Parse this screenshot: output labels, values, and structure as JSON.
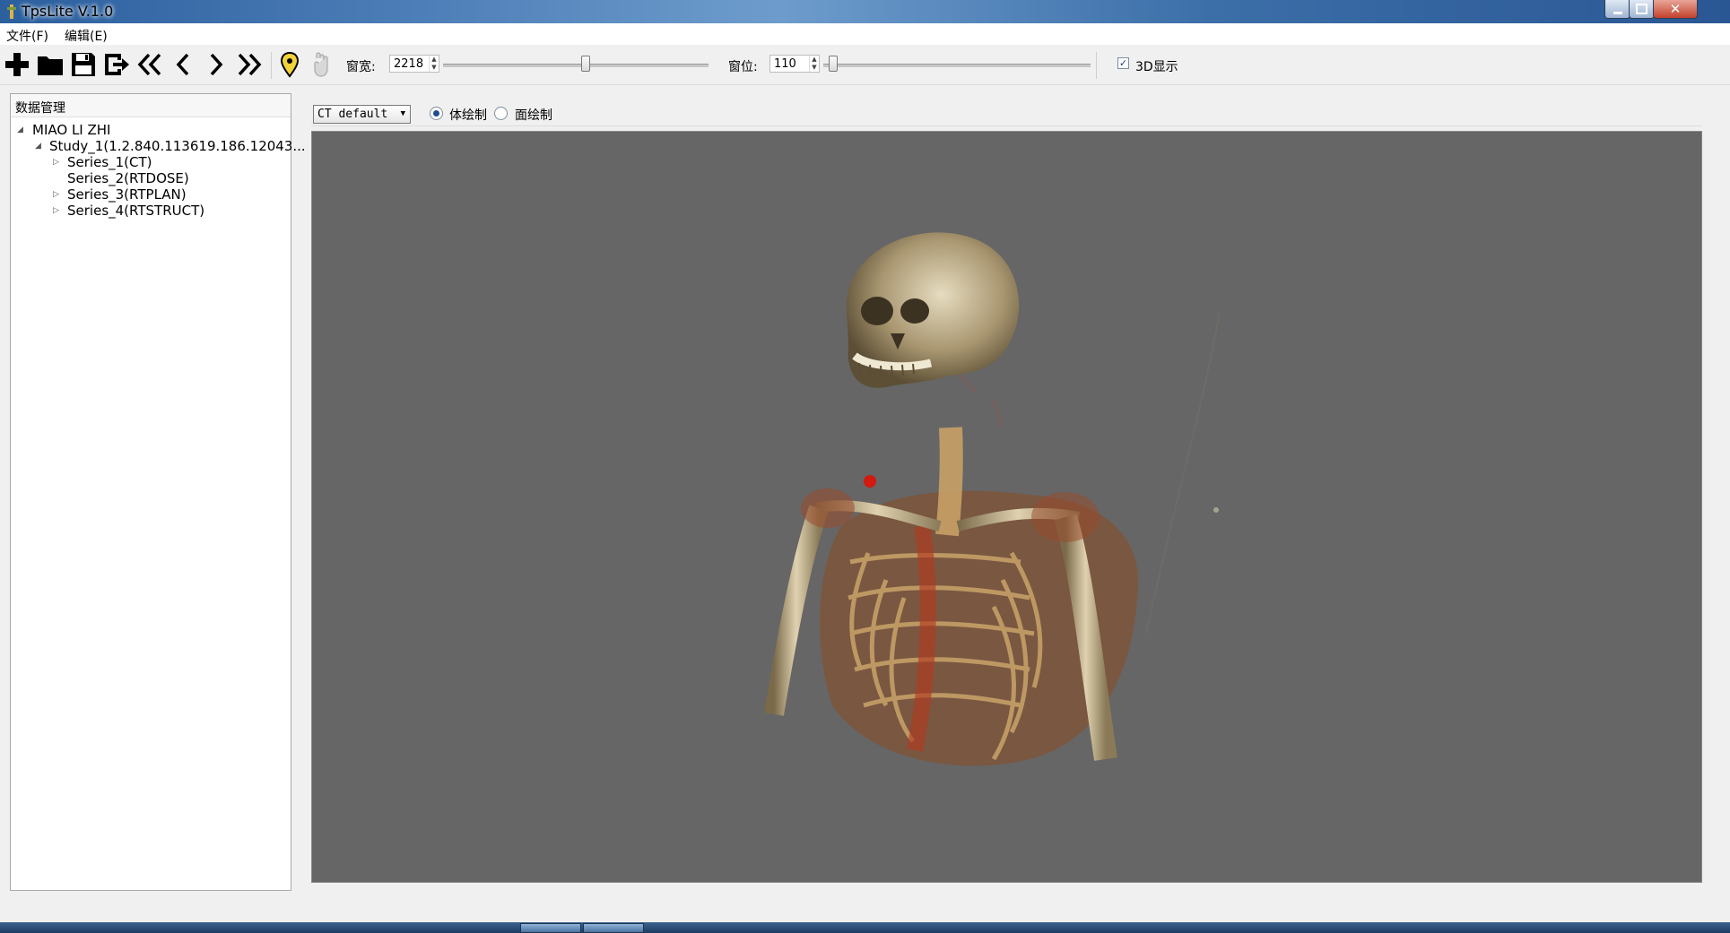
{
  "window": {
    "title": "TpsLite V.1.0"
  },
  "menu": {
    "file": "文件(F)",
    "edit": "编辑(E)"
  },
  "toolbar": {
    "window_width_label": "窗宽:",
    "window_width_value": "2218",
    "window_width_slider_fraction": 0.54,
    "window_level_label": "窗位:",
    "window_level_value": "110",
    "window_level_slider_fraction": 0.02,
    "display_3d_label": "3D显示",
    "display_3d_checked": true
  },
  "data_panel": {
    "title": "数据管理",
    "patient": "MIAO LI ZHI",
    "study": "Study_1(1.2.840.113619.186.12043...",
    "series": [
      "Series_1(CT)",
      "Series_2(RTDOSE)",
      "Series_3(RTPLAN)",
      "Series_4(RTSTRUCT)"
    ]
  },
  "render": {
    "preset": "CT default",
    "mode_volume": "体绘制",
    "mode_surface": "面绘制",
    "selected_mode": "volume"
  },
  "colors": {
    "viewport_bg": "#666666",
    "titlebar": "#3c6ea8",
    "bone": "#c9b48a",
    "tissue": "#9a3a1e"
  },
  "icons": [
    "add-icon",
    "folder-open-icon",
    "save-icon",
    "export-icon",
    "first-icon",
    "previous-icon",
    "next-icon",
    "last-icon",
    "marker-pin-icon",
    "hand-icon"
  ]
}
